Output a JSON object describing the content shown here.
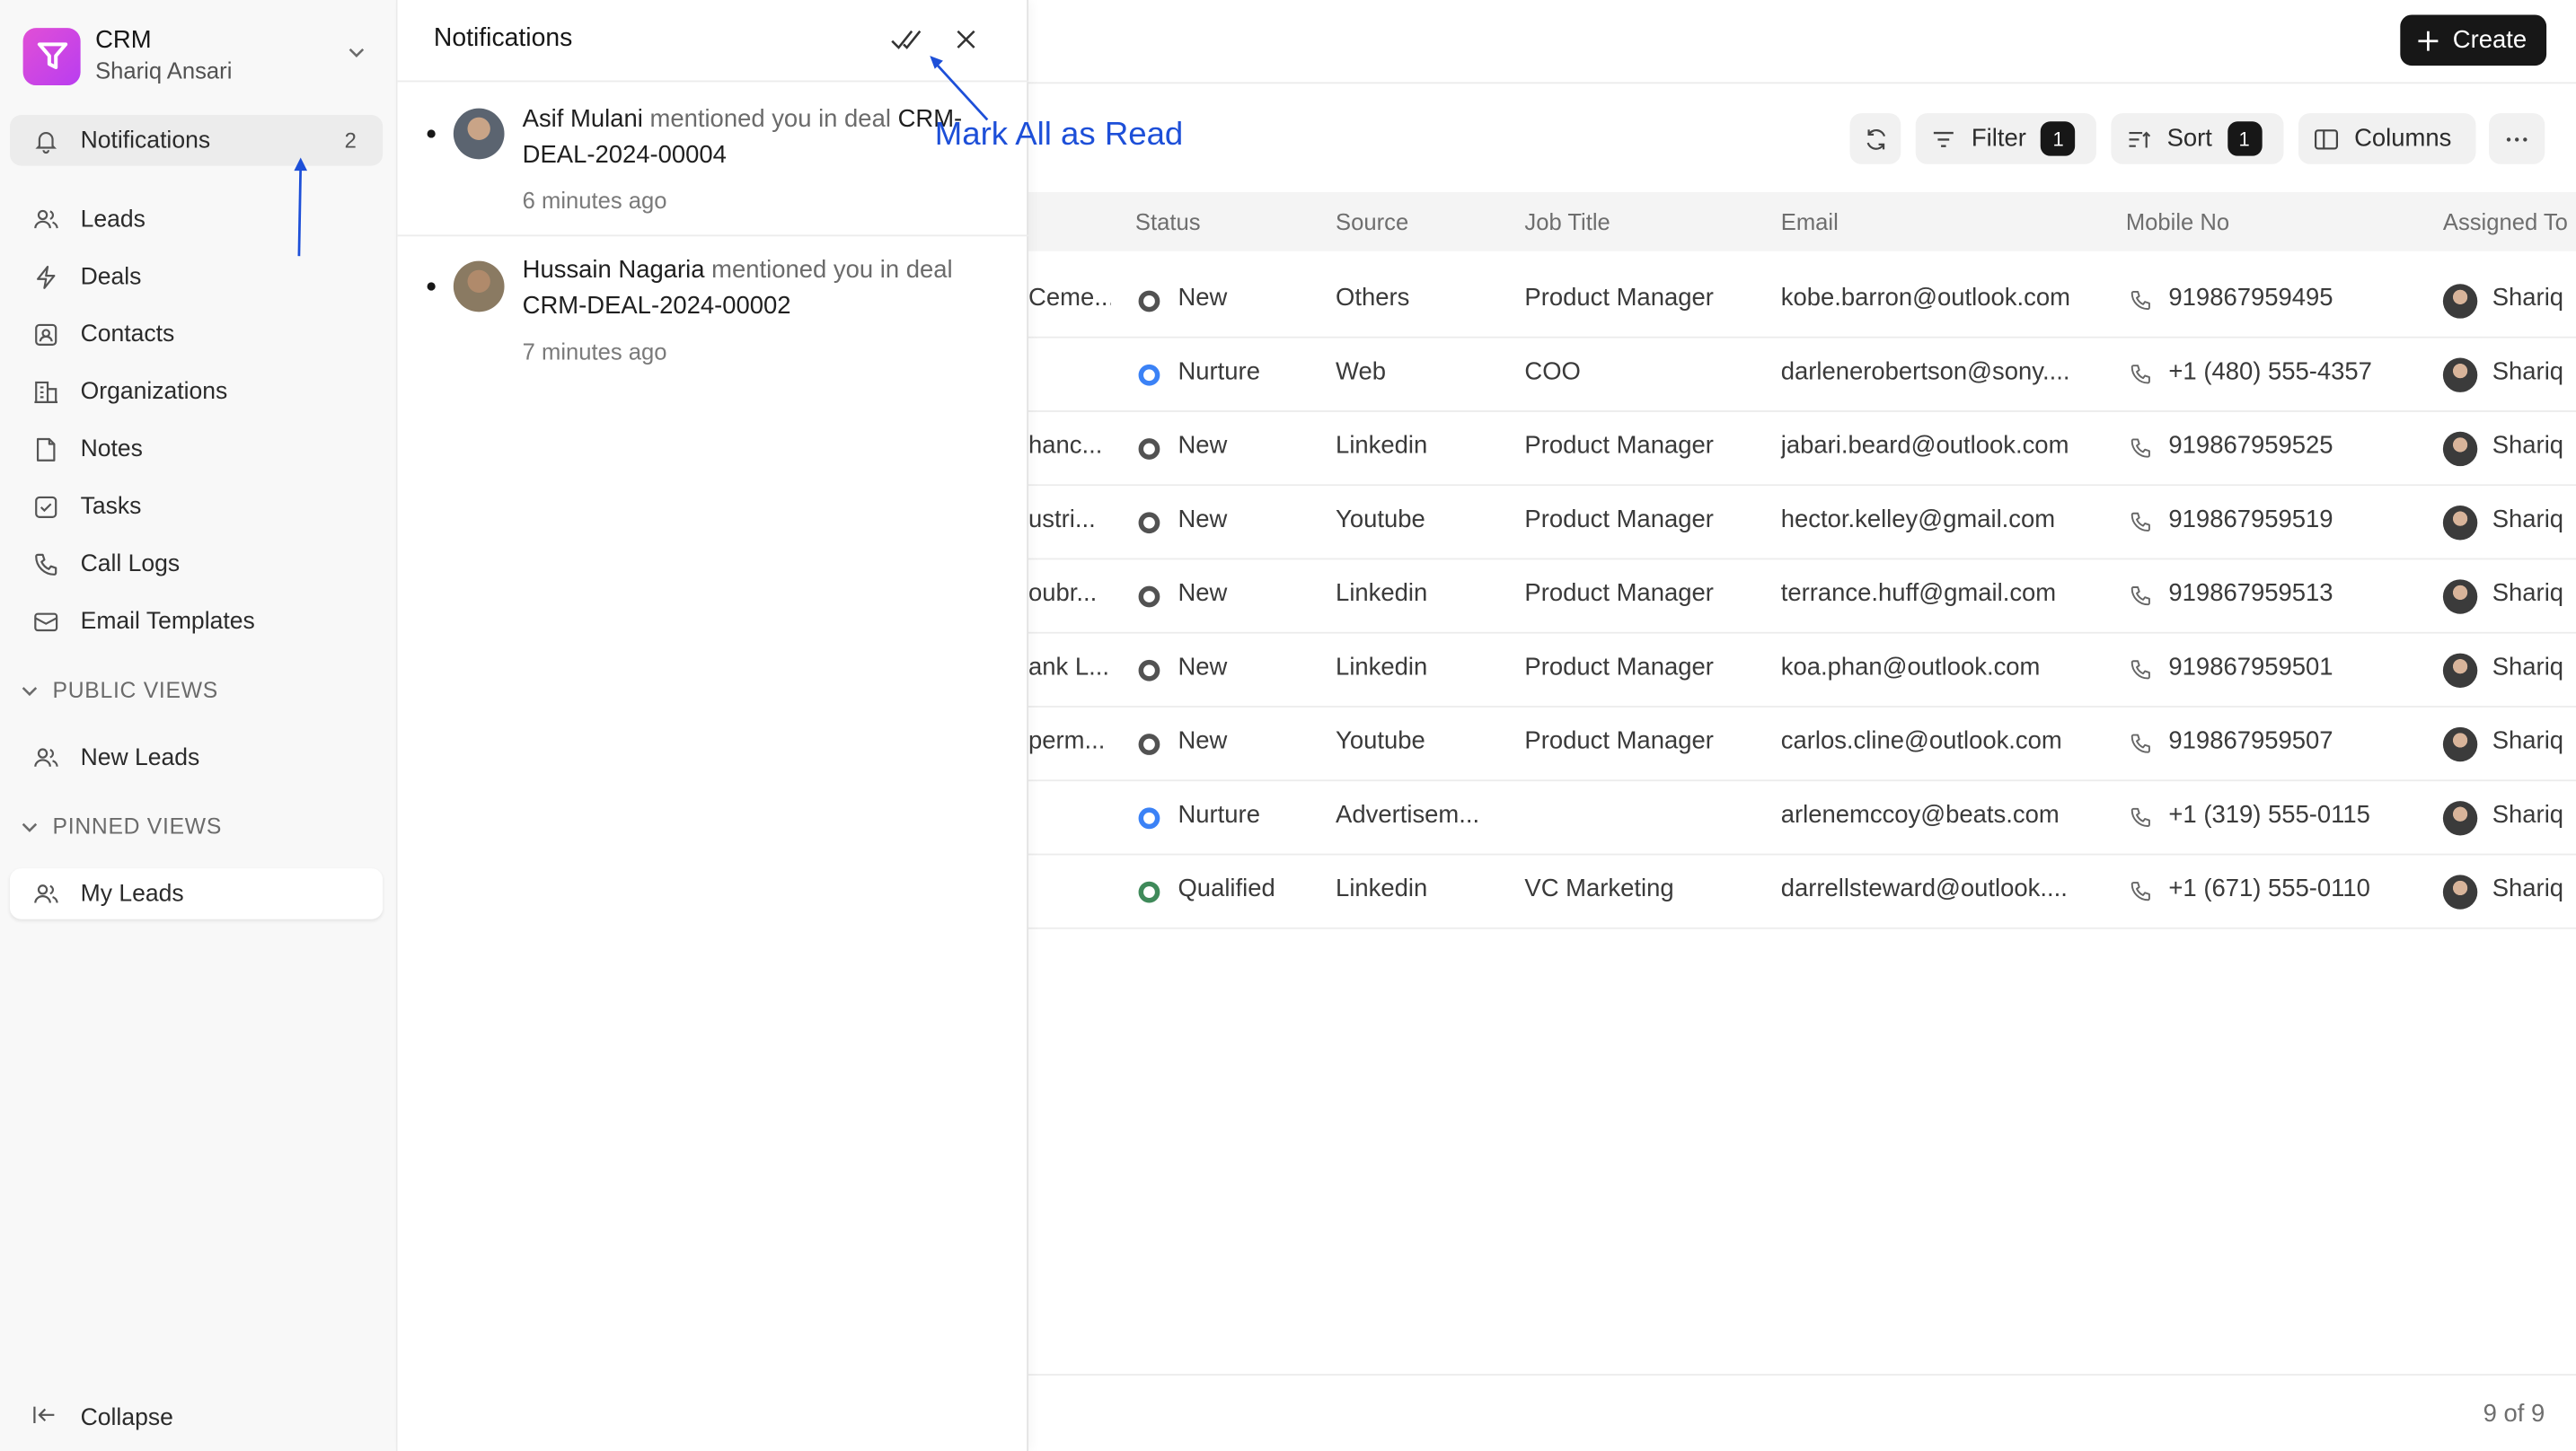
{
  "brand": {
    "title": "CRM",
    "user": "Shariq Ansari"
  },
  "sidebar": {
    "notifications": {
      "label": "Notifications",
      "count": "2"
    },
    "items": [
      {
        "label": "Leads",
        "icon": "users-icon"
      },
      {
        "label": "Deals",
        "icon": "lightning-icon"
      },
      {
        "label": "Contacts",
        "icon": "contact-icon"
      },
      {
        "label": "Organizations",
        "icon": "building-icon"
      },
      {
        "label": "Notes",
        "icon": "note-icon"
      },
      {
        "label": "Tasks",
        "icon": "check-square-icon"
      },
      {
        "label": "Call Logs",
        "icon": "phone-icon"
      },
      {
        "label": "Email Templates",
        "icon": "mail-icon"
      }
    ],
    "public_views_label": "PUBLIC VIEWS",
    "public_views": [
      {
        "label": "New Leads"
      }
    ],
    "pinned_views_label": "PINNED VIEWS",
    "pinned_views": [
      {
        "label": "My Leads"
      }
    ],
    "collapse_label": "Collapse"
  },
  "topbar": {
    "create_label": "Create"
  },
  "toolbar": {
    "filter_label": "Filter",
    "filter_count": "1",
    "sort_label": "Sort",
    "sort_count": "1",
    "columns_label": "Columns"
  },
  "table": {
    "columns": [
      "Status",
      "Source",
      "Job Title",
      "Email",
      "Mobile No",
      "Assigned To"
    ],
    "rows": [
      {
        "org": "Ceme...",
        "status": "New",
        "source": "Others",
        "job": "Product Manager",
        "email": "kobe.barron@outlook.com",
        "mobile": "919867959495",
        "assigned": "Shariq"
      },
      {
        "org": "",
        "status": "Nurture",
        "source": "Web",
        "job": "COO",
        "email": "darlenerobertson@sony....",
        "mobile": "+1 (480) 555-4357",
        "assigned": "Shariq"
      },
      {
        "org": "hanc...",
        "status": "New",
        "source": "Linkedin",
        "job": "Product Manager",
        "email": "jabari.beard@outlook.com",
        "mobile": "919867959525",
        "assigned": "Shariq"
      },
      {
        "org": "ustri...",
        "status": "New",
        "source": "Youtube",
        "job": "Product Manager",
        "email": "hector.kelley@gmail.com",
        "mobile": "919867959519",
        "assigned": "Shariq"
      },
      {
        "org": "oubr...",
        "status": "New",
        "source": "Linkedin",
        "job": "Product Manager",
        "email": "terrance.huff@gmail.com",
        "mobile": "919867959513",
        "assigned": "Shariq"
      },
      {
        "org": "ank L...",
        "status": "New",
        "source": "Linkedin",
        "job": "Product Manager",
        "email": "koa.phan@outlook.com",
        "mobile": "919867959501",
        "assigned": "Shariq"
      },
      {
        "org": "perm...",
        "status": "New",
        "source": "Youtube",
        "job": "Product Manager",
        "email": "carlos.cline@outlook.com",
        "mobile": "919867959507",
        "assigned": "Shariq"
      },
      {
        "org": "",
        "status": "Nurture",
        "source": "Advertisem...",
        "job": "",
        "email": "arlenemccoy@beats.com",
        "mobile": "+1 (319) 555-0115",
        "assigned": "Shariq"
      },
      {
        "org": "",
        "status": "Qualified",
        "source": "Linkedin",
        "job": "VC Marketing",
        "email": "darrellsteward@outlook....",
        "mobile": "+1 (671) 555-0110",
        "assigned": "Shariq"
      }
    ],
    "pager": "9 of 9"
  },
  "status_colors": {
    "New": "#525252",
    "Nurture": "#3b82f6",
    "Qualified": "#3f8a5a"
  },
  "notifications_panel": {
    "title": "Notifications",
    "items": [
      {
        "name": "Asif Mulani",
        "text": "mentioned you in deal",
        "ref": "CRM-DEAL-2024-00004",
        "time": "6 minutes ago"
      },
      {
        "name": "Hussain Nagaria",
        "text": "mentioned you in deal",
        "ref": "CRM-DEAL-2024-00002",
        "time": "7 minutes ago"
      }
    ]
  },
  "annotation": {
    "label": "Mark All as Read",
    "color": "#1d4fd8"
  }
}
